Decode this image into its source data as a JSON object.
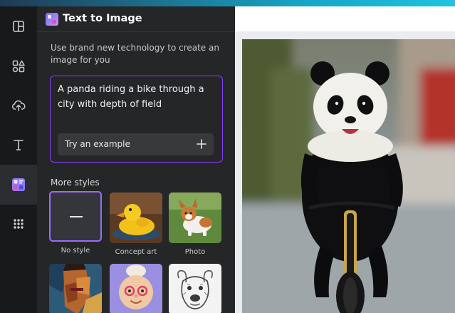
{
  "app": {
    "title": "Text to Image",
    "description": "Use brand new technology to create an image for you"
  },
  "prompt": {
    "value": "A panda riding a bike through a city with depth of field",
    "example_button_label": "Try an example"
  },
  "styles": {
    "heading": "More styles",
    "items": [
      {
        "label": "No style",
        "selected": true
      },
      {
        "label": "Concept art",
        "selected": false
      },
      {
        "label": "Photo",
        "selected": false
      },
      {
        "label": "",
        "selected": false
      },
      {
        "label": "",
        "selected": false
      },
      {
        "label": "",
        "selected": false
      }
    ]
  },
  "sidebar": {
    "items": [
      {
        "icon": "layout-icon"
      },
      {
        "icon": "elements-icon"
      },
      {
        "icon": "upload-icon"
      },
      {
        "icon": "text-icon"
      },
      {
        "icon": "text-to-image-icon",
        "active": true
      },
      {
        "icon": "apps-grid-icon"
      }
    ]
  },
  "colors": {
    "accent": "#8b3dff",
    "panel_bg": "#252627",
    "rail_bg": "#18191b"
  }
}
